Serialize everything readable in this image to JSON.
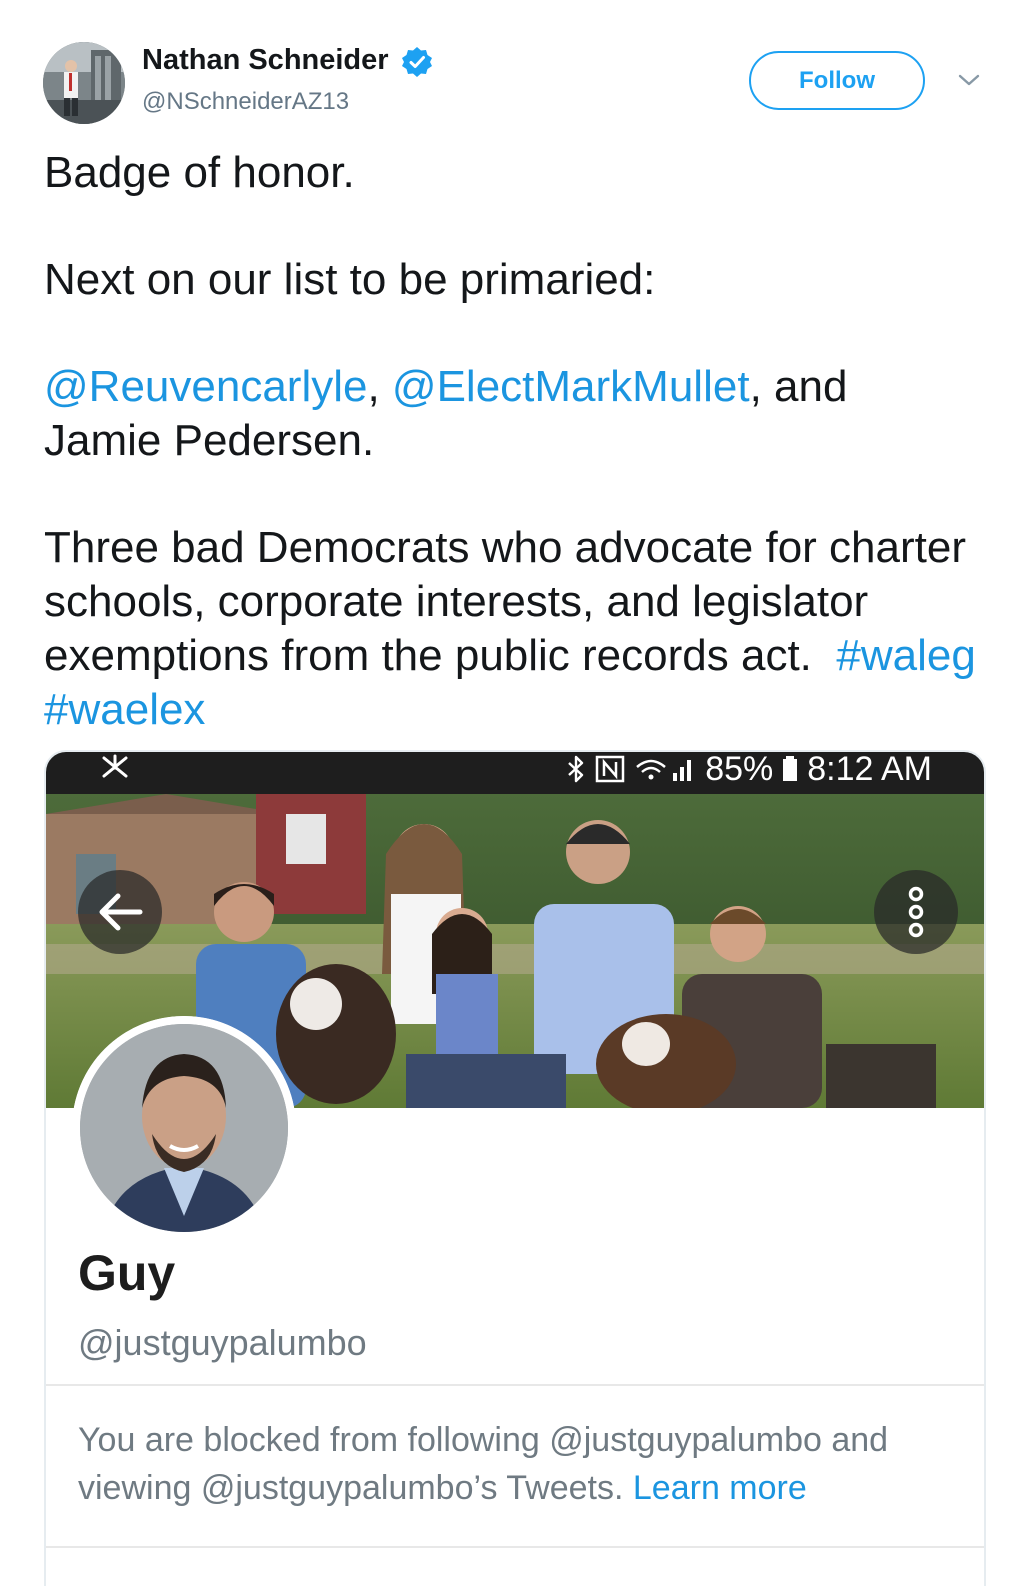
{
  "tweet": {
    "author_name": "Nathan Schneider",
    "author_handle": "@NSchneiderAZ13",
    "follow_label": "Follow",
    "body": {
      "line1": "Badge of honor.",
      "line2": "Next on our list to be primaried:",
      "mention1": "@Reuvencarlyle",
      "sep1": ", ",
      "mention2": "@ElectMarkMullet",
      "sep2": ", and",
      "line3_tail": "Jamie Pedersen.",
      "line4": "Three bad Democrats who advocate for charter schools, corporate interests, and legislator exemptions from the public records act.",
      "hashtag1": "#waleg",
      "hashtag2": "#waelex"
    }
  },
  "embedded_screenshot": {
    "status_bar": {
      "battery": "85%",
      "time": "8:12 AM"
    },
    "profile": {
      "name": "Guy",
      "handle": "@justguypalumbo",
      "blocked_text": "You are blocked from following @justguypalumbo and viewing @justguypalumbo’s Tweets.",
      "learn_more": "Learn more"
    }
  },
  "colors": {
    "link": "#1b95e0",
    "follow_accent": "#1da1f2",
    "verified": "#1da1f2",
    "secondary_text": "#657786"
  },
  "icons": {
    "verified": "verified-badge-icon",
    "caret": "chevron-down-icon",
    "back": "arrow-left-icon",
    "more": "more-vertical-icon"
  }
}
